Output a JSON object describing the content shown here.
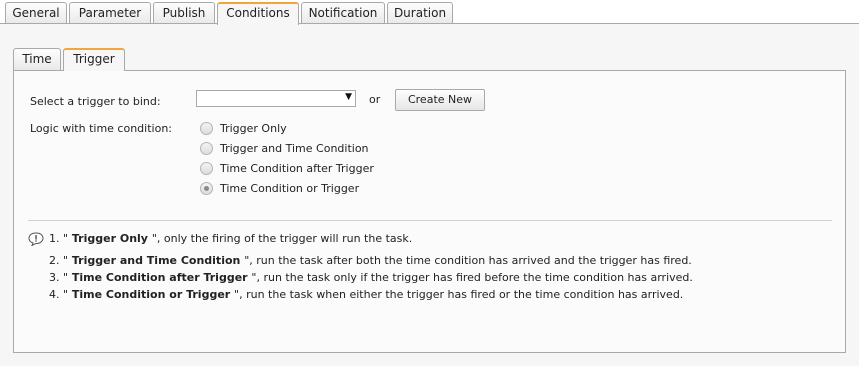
{
  "top_tabs": [
    {
      "label": "General"
    },
    {
      "label": "Parameter"
    },
    {
      "label": "Publish"
    },
    {
      "label": "Conditions"
    },
    {
      "label": "Notification"
    },
    {
      "label": "Duration"
    }
  ],
  "inner_tabs": [
    {
      "label": "Time"
    },
    {
      "label": "Trigger"
    }
  ],
  "trigger": {
    "select_label": "Select a trigger to bind:",
    "selected_value": "",
    "or_text": "or",
    "create_new_label": "Create New"
  },
  "logic": {
    "label": "Logic with time condition:",
    "options": [
      {
        "label": "Trigger Only"
      },
      {
        "label": "Trigger and Time Condition"
      },
      {
        "label": "Time Condition after Trigger"
      },
      {
        "label": "Time Condition or Trigger"
      }
    ],
    "selected": "Time Condition or Trigger"
  },
  "notes": [
    {
      "num": "1. \"",
      "term": " Trigger Only ",
      "rest": "\", only the firing of the trigger will run the task."
    },
    {
      "num": "2. \"",
      "term": " Trigger and Time Condition ",
      "rest": "\", run the task after both the time condition has arrived and the trigger has fired."
    },
    {
      "num": "3. \"",
      "term": " Time Condition after Trigger ",
      "rest": "\", run the task only if the trigger has fired before the time condition has arrived."
    },
    {
      "num": "4. \"",
      "term": " Time Condition or Trigger ",
      "rest": "\", run the task when either the trigger has fired or the time condition has arrived."
    }
  ],
  "colors": {
    "active_tab_accent": "#f2a53b"
  }
}
